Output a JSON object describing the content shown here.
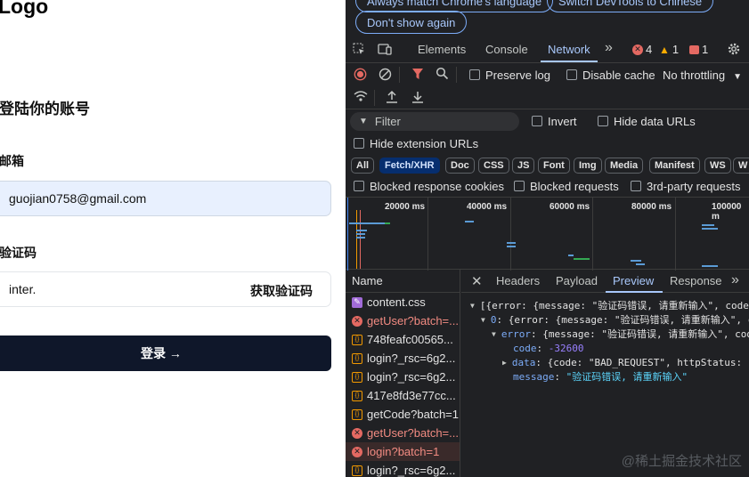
{
  "page": {
    "logo": "Logo",
    "title": "登陆你的账号",
    "email_label": "邮箱",
    "email_value": "guojian0758@gmail.com",
    "code_label": "验证码",
    "code_value": "inter.",
    "get_code": "获取验证码",
    "login_button": "登录 →"
  },
  "devtools": {
    "notice": {
      "match_language": "Always match Chrome's language",
      "switch_chinese": "Switch DevTools to Chinese",
      "dont_show": "Don't show again"
    },
    "tabs": [
      "Elements",
      "Console",
      "Network"
    ],
    "active_tab": "Network",
    "more": "»",
    "errors": "4",
    "warnings": "1",
    "issues": "1",
    "preserve_log": "Preserve log",
    "disable_cache": "Disable cache",
    "throttling": "No throttling",
    "filter_placeholder": "Filter",
    "invert": "Invert",
    "hide_data_urls": "Hide data URLs",
    "hide_extension_urls": "Hide extension URLs",
    "type_filters": [
      "All",
      "Fetch/XHR",
      "Doc",
      "CSS",
      "JS",
      "Font",
      "Img",
      "Media",
      "Manifest",
      "WS",
      "W"
    ],
    "active_filter": "Fetch/XHR",
    "blocked_cookies": "Blocked response cookies",
    "blocked_requests": "Blocked requests",
    "third_party": "3rd-party requests",
    "timeline_labels": [
      "20000 ms",
      "40000 ms",
      "60000 ms",
      "80000 ms",
      "100000 m"
    ],
    "name_header": "Name",
    "requests": [
      {
        "name": "content.css",
        "type": "css",
        "status": "ok"
      },
      {
        "name": "getUser?batch=...",
        "type": "err",
        "status": "error"
      },
      {
        "name": "748feafc00565...",
        "type": "xhr",
        "status": "ok"
      },
      {
        "name": "login?_rsc=6g2...",
        "type": "xhr",
        "status": "ok"
      },
      {
        "name": "login?_rsc=6g2...",
        "type": "xhr",
        "status": "ok"
      },
      {
        "name": "417e8fd3e77cc...",
        "type": "xhr",
        "status": "ok"
      },
      {
        "name": "getCode?batch=1",
        "type": "xhr",
        "status": "ok"
      },
      {
        "name": "getUser?batch=...",
        "type": "err",
        "status": "error"
      },
      {
        "name": "login?batch=1",
        "type": "err",
        "status": "error"
      },
      {
        "name": "login?_rsc=6g2...",
        "type": "xhr",
        "status": "ok"
      }
    ],
    "detail_tabs": [
      "Headers",
      "Payload",
      "Preview",
      "Response",
      "»"
    ],
    "active_detail_tab": "Preview",
    "preview": {
      "line1": "[{error: {message: \"验证码错误, 请重新输入\", code",
      "line2_key": "0",
      "line2": ": {error: {message: \"验证码错误, 请重新输入\", c",
      "line3_key": "error",
      "line3": ": {message: \"验证码错误, 请重新输入\", cod",
      "code_key": "code",
      "code_value": "-32600",
      "data_key": "data",
      "data_value": ": {code: \"BAD_REQUEST\", httpStatus:",
      "message_key": "message",
      "message_value": "\"验证码错误, 请重新输入\""
    },
    "watermark": "@稀土掘金技术社区"
  }
}
